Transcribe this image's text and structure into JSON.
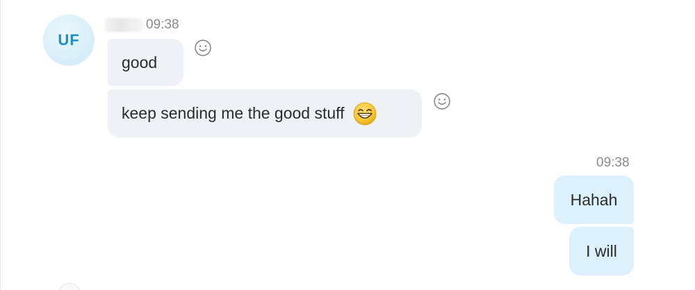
{
  "conversation": {
    "incoming_group": {
      "avatar_initials": "UF",
      "timestamp": "09:38",
      "messages": [
        {
          "text": "good"
        },
        {
          "text": "keep sending me the good stuff",
          "emoji": "grinning-face-emoji"
        }
      ]
    },
    "outgoing_group": {
      "timestamp": "09:38",
      "messages": [
        {
          "text": "Hahah"
        },
        {
          "text": "I will"
        }
      ]
    }
  },
  "icons": {
    "reaction": "add-reaction-smiley-icon"
  },
  "colors": {
    "incoming_bubble": "#eef1f6",
    "outgoing_bubble": "#dcf1fc",
    "avatar_text": "#1c8fc4",
    "timestamp": "#8a8a8a"
  }
}
